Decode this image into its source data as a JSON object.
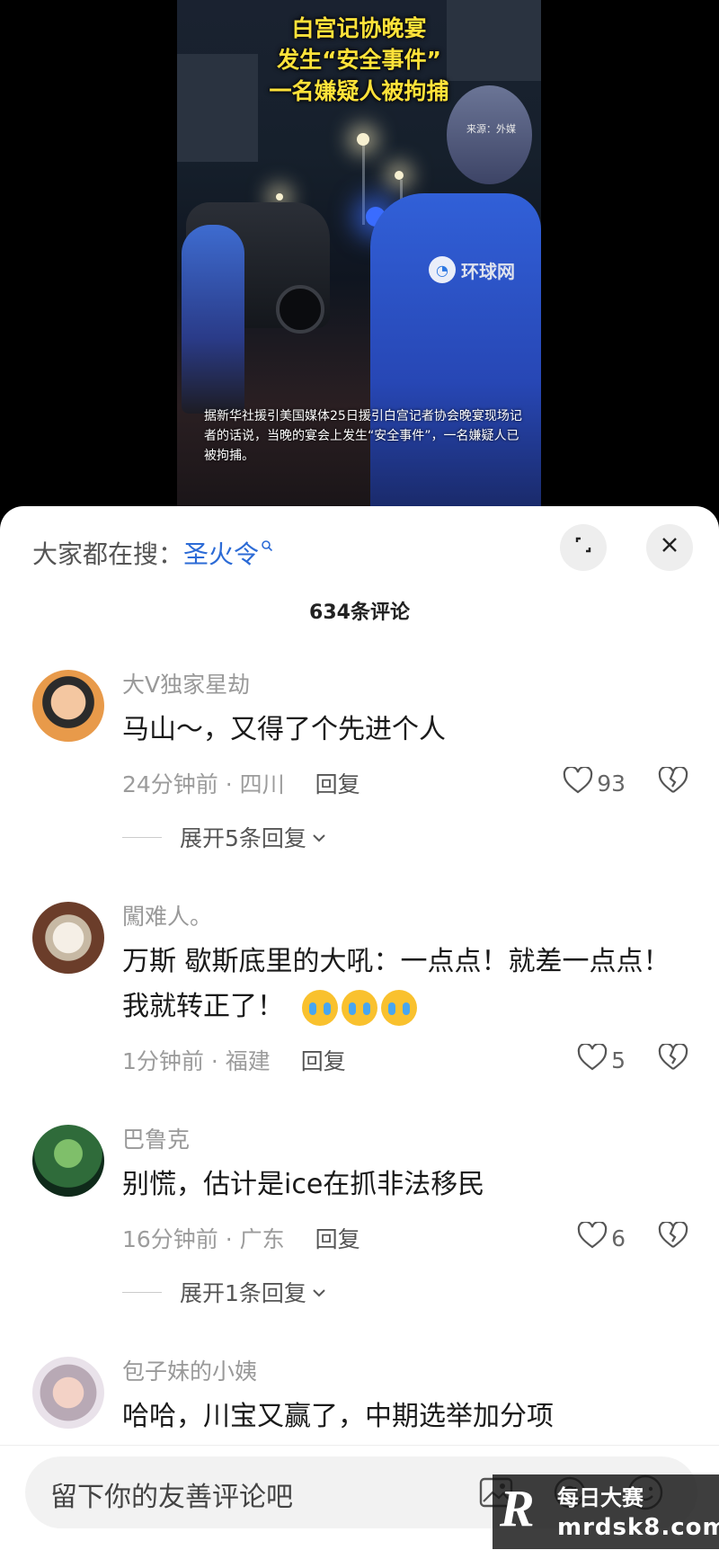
{
  "video": {
    "title_lines": [
      "白宫记协晚宴",
      "发生“安全事件”",
      "一名嫌疑人被拘捕"
    ],
    "source_label": "来源：外媒",
    "watermark": "环球网",
    "caption": "据新华社援引美国媒体25日援引白宫记者协会晚宴现场记者的话说，当晚的宴会上发生“安全事件”，一名嫌疑人已被拘捕。"
  },
  "sheet": {
    "search_prefix": "大家都在搜：",
    "search_term": "圣火令",
    "comment_count": "634条评论"
  },
  "comments": [
    {
      "user": "大V独家星劫",
      "text": "马山～，又得了个先进个人",
      "time_location": "24分钟前 · 四川",
      "reply_label": "回复",
      "likes": "93",
      "expand_replies": "展开5条回复"
    },
    {
      "user": "闖难人。",
      "text": "万斯 歇斯底里的大吼：一点点！就差一点点！我就转正了！",
      "time_location": "1分钟前 · 福建",
      "reply_label": "回复",
      "likes": "5"
    },
    {
      "user": "巴鲁克",
      "text": "别慌，估计是ice在抓非法移民",
      "time_location": "16分钟前 · 广东",
      "reply_label": "回复",
      "likes": "6",
      "expand_replies": "展开1条回复"
    },
    {
      "user": "包子妹的小姨",
      "text": "哈哈，川宝又赢了，中期选举加分项"
    }
  ],
  "input": {
    "placeholder": "留下你的友善评论吧"
  },
  "site_watermark": {
    "name": "每日大赛",
    "url": "mrdsk8.com",
    "logo_letter": "R"
  },
  "colors": {
    "title_yellow": "#ffe23a",
    "search_blue": "#2c6bd6",
    "emoji_yellow": "#f9c12e"
  },
  "icons": [
    "search-icon",
    "expand-icon",
    "close-icon",
    "heart-icon",
    "broken-heart-icon",
    "chevron-down-icon",
    "image-icon",
    "at-icon",
    "emoji-icon"
  ]
}
